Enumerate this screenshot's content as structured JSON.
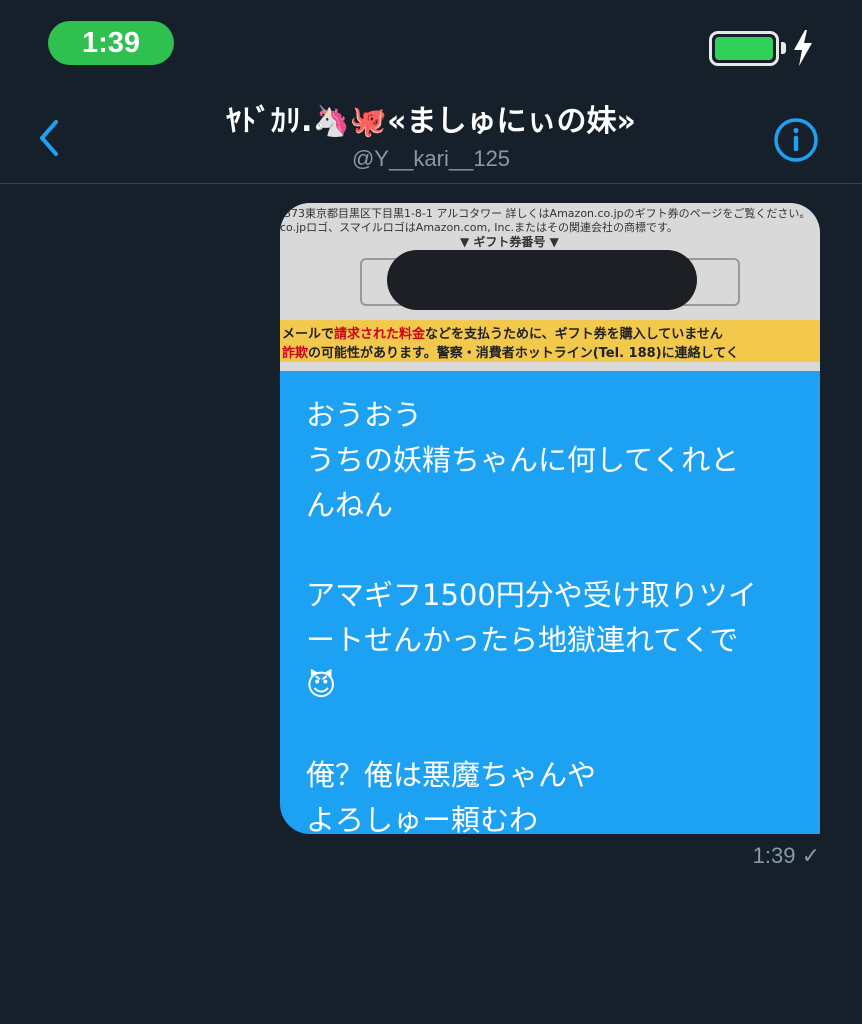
{
  "status_bar": {
    "time": "1:39",
    "battery_color": "#30d158",
    "pill_color": "#30c04f"
  },
  "header": {
    "title": "ﾔﾄﾞｶﾘ.🦄🐙«ましゅにぃの妹»",
    "handle": "@Y__kari__125",
    "back_icon": "chevron-left-icon",
    "info_icon": "info-circle-icon",
    "accent": "#1da1f2"
  },
  "message": {
    "attachment": {
      "receipt_line_1": "-373東京都目黒区下目黒1-8-1 アルコタワー 詳しくはAmazon.co.jpのギフト券のページをご覧ください。",
      "receipt_line_2": "co.jpロゴ、スマイルロゴはAmazon.com, Inc.またはその関連会社の商標です。",
      "gift_label": "▼ ギフト券番号 ▼",
      "warning_line_1_pre": "メールで",
      "warning_line_1_red": "請求された料金",
      "warning_line_1_post": "などを支払うために、ギフト券を購入していません",
      "warning_line_2_red": "詐欺",
      "warning_line_2_post": "の可能性があります。警察・消費者ホットライン(Tel. 188)に連絡してく"
    },
    "text": "おうおう\nうちの妖精ちゃんに何してくれと\nんねん\n\nアマギフ1500円分や受け取りツイ\nートせんかったら地獄連れてくで\n😈\n\n俺？俺は悪魔ちゃんや\nよろしゅー頼むわ",
    "time": "1:39",
    "status": "✓",
    "bubble_color": "#1da1f2"
  }
}
